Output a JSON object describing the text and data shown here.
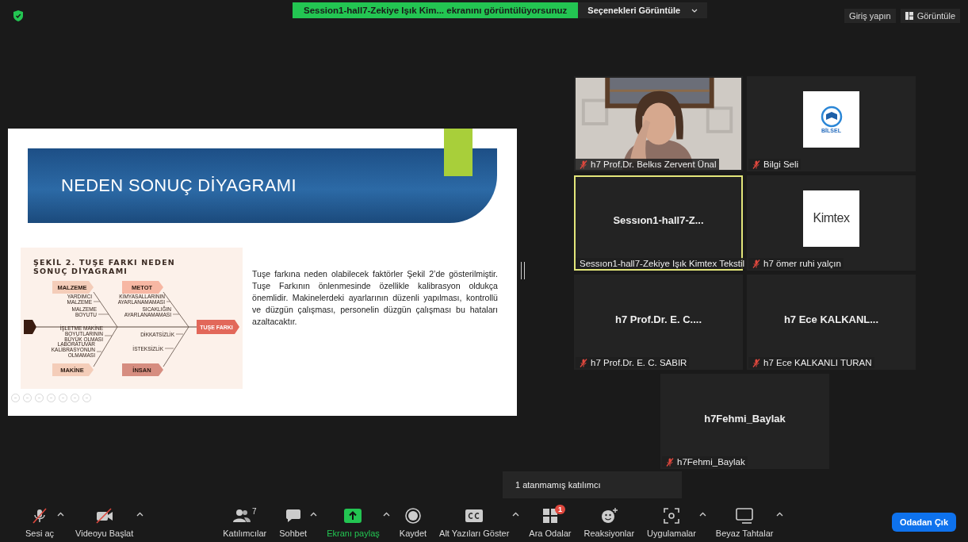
{
  "top_bar": {
    "security": true,
    "share_banner": "Session1-hall7-Zekiye Işık Kim... ekranını görüntülüyorsunuz",
    "view_options": "Seçenekleri Görüntüle",
    "sign_in": "Giriş yapın",
    "view": "Görüntüle"
  },
  "slide": {
    "title": "NEDEN SONUÇ DİYAGRAMI",
    "figure": {
      "title_lines": [
        "ŞEKİL 2. TUŞE FARKI NEDEN",
        "SONUÇ DİYAGRAMI"
      ],
      "categories": [
        {
          "label": "MALZEME",
          "color": "#f4cdb9"
        },
        {
          "label": "METOT",
          "color": "#f7b7a3"
        },
        {
          "label": "MAKİNE",
          "color": "#f4cdb9"
        },
        {
          "label": "İNSAN",
          "color": "#d68d80"
        }
      ],
      "causes": [
        {
          "lines": [
            "YARDIMCI",
            "MALZEME"
          ]
        },
        {
          "lines": [
            "MALZEME",
            "BOYUTU"
          ]
        },
        {
          "lines": [
            "İŞLETME MAKİNE",
            "BOYUTLARININ",
            "BÜYÜK OLMASI"
          ]
        },
        {
          "lines": [
            "LABORATUVAR",
            "KALİBRASYONUN",
            "OLMAMASI"
          ]
        },
        {
          "lines": [
            "KİMYASALLARININ",
            "AYARLANAMAMASI"
          ]
        },
        {
          "lines": [
            "SICAKLIĞIN",
            "AYARLANAMAMASI"
          ]
        },
        {
          "lines": [
            "DİKKATSİZLİK"
          ]
        },
        {
          "lines": [
            "İSTEKSİZLİK"
          ]
        }
      ],
      "effect": "TUŞE FARKI"
    },
    "paragraph": "Tuşe farkına neden olabilecek faktörler Şekil 2’de gösterilmiştir. Tuşe Farkının önlenmesinde özellikle kalibrasyon oldukça önemlidir. Makinelerdeki ayarlarının düzenli yapılması, kontrollü ve düzgün çalışması, personelin düzgün çalışması bu hataları azaltacaktır."
  },
  "participants": [
    {
      "kind": "video",
      "label": "h7 Prof.Dr. Belkıs Zervent Ünal",
      "muted": true,
      "highlighted": false
    },
    {
      "kind": "emblem",
      "logo_text": "BİLSEL",
      "label": "Bilgi Seli",
      "muted": true,
      "highlighted": false
    },
    {
      "kind": "name",
      "display_name": "Sessıon1-hall7-Z...",
      "label": "Sessıon1-hall7-Zekiye Işık Kimtex Tekstil",
      "muted": false,
      "highlighted": true
    },
    {
      "kind": "wordmark",
      "logo_text": "Kimtex",
      "label": "h7 ömer ruhi yalçın",
      "muted": true,
      "highlighted": false
    },
    {
      "kind": "name",
      "display_name": "h7 Prof.Dr. E. C....",
      "label": "h7 Prof.Dr. E. C. SABIR",
      "muted": true,
      "highlighted": false
    },
    {
      "kind": "name",
      "display_name": "h7 Ece KALKANL...",
      "label": "h7 Ece KALKANLI TURAN",
      "muted": true,
      "highlighted": false
    },
    {
      "kind": "name",
      "display_name": "h7Fehmi_Baylak",
      "label": "h7Fehmi_Baylak",
      "muted": true,
      "highlighted": false
    }
  ],
  "tooltip": "1 atanmamış katılımcı",
  "toolbar": [
    {
      "kind": "mic",
      "label": "Sesi aç",
      "caret": true,
      "active": false
    },
    {
      "kind": "camera",
      "label": "Videoyu Başlat",
      "caret": true,
      "active": false
    },
    {
      "kind": "people",
      "label": "Katılımcılar",
      "count": "7",
      "caret": false,
      "active": false
    },
    {
      "kind": "chat",
      "label": "Sohbet",
      "caret": true,
      "active": false
    },
    {
      "kind": "share",
      "label": "Ekranı paylaş",
      "caret": true,
      "active": true
    },
    {
      "kind": "record",
      "label": "Kaydet",
      "caret": false,
      "active": false
    },
    {
      "kind": "captions",
      "label": "Alt Yazıları Göster",
      "caret": true,
      "active": false
    },
    {
      "kind": "rooms",
      "label": "Ara Odalar",
      "badge": "1",
      "caret": false,
      "active": false
    },
    {
      "kind": "reactions",
      "label": "Reaksiyonlar",
      "caret": false,
      "active": false
    },
    {
      "kind": "apps",
      "label": "Uygulamalar",
      "caret": true,
      "active": false
    },
    {
      "kind": "whiteboard",
      "label": "Beyaz Tahtalar",
      "caret": true,
      "active": false
    }
  ],
  "leave_button": "Odadan Çık"
}
